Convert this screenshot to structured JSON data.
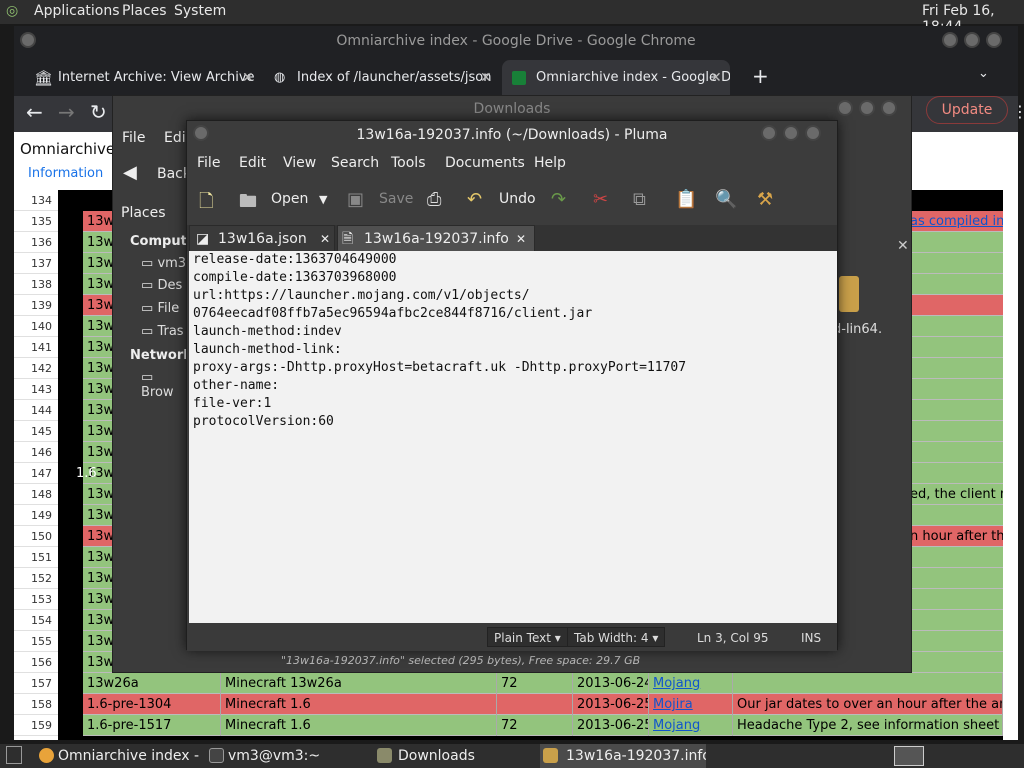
{
  "top_panel": {
    "applications": "Applications",
    "places": "Places",
    "system": "System",
    "clock": "Fri Feb 16, 18:44"
  },
  "chrome": {
    "title": "Omniarchive index - Google Drive - Google Chrome",
    "tabs": [
      {
        "label": "Internet Archive: View Archive"
      },
      {
        "label": "Index of /launcher/assets/json"
      },
      {
        "label": "Omniarchive index - Google D"
      }
    ],
    "update": "Update"
  },
  "sheet": {
    "title": "Omniarchive i",
    "info": "Information",
    "row_numbers": [
      "134",
      "135",
      "136",
      "137",
      "138",
      "139",
      "140",
      "141",
      "142",
      "143",
      "144",
      "145",
      "146",
      "147",
      "148",
      "149",
      "150",
      "151",
      "152",
      "153",
      "154",
      "155",
      "156",
      "157",
      "158",
      "159"
    ],
    "row_label_147": "1.6",
    "right_texts": {
      "r135": "as compiled in",
      "r139": "",
      "r148": "ed, the client m",
      "r150": "n hour after the"
    },
    "rows": [
      {
        "id": "13w26a",
        "name": "Minecraft 13w26a",
        "proto": "72",
        "date": "2013-06-24",
        "src": "Mojang",
        "note": ""
      },
      {
        "id": "1.6-pre-1304",
        "name": "Minecraft 1.6",
        "proto": "",
        "date": "2013-06-25",
        "src": "Mojira",
        "note": "Our jar dates to over an hour after the annou"
      },
      {
        "id": "1.6-pre-1517",
        "name": "Minecraft 1.6",
        "proto": "72",
        "date": "2013-06-25",
        "src": "Mojang",
        "note": "Headache Type 2, see information sheet"
      }
    ],
    "short_ids": [
      "13w",
      "13w",
      "13w",
      "13w",
      "13w",
      "13w",
      "13w",
      "13w",
      "13w",
      "13w",
      "13w",
      "13w",
      "13w",
      "13w",
      "13w",
      "13w",
      "13w",
      "13w",
      "13w",
      "13w",
      "13w",
      "13w26"
    ]
  },
  "downloads": {
    "title": "Downloads",
    "menu": {
      "file": "File",
      "edit": "Edit"
    },
    "back": "Back",
    "places_label": "Places",
    "sidebar": {
      "computer": "Compute",
      "vm3": "vm3",
      "desktop": "Des",
      "filesystem": "File",
      "trash": "Tras",
      "network": "Network",
      "browse": "Brow"
    },
    "file_label": "ed-lin64.",
    "status": "\"13w16a-192037.info\" selected (295 bytes), Free space: 29.7 GB"
  },
  "pluma": {
    "title": "13w16a-192037.info (~/Downloads) - Pluma",
    "menu": [
      "File",
      "Edit",
      "View",
      "Search",
      "Tools",
      "Documents",
      "Help"
    ],
    "toolbar": {
      "open": "Open",
      "save": "Save",
      "undo": "Undo"
    },
    "tabs": [
      {
        "label": "13w16a.json"
      },
      {
        "label": "13w16a-192037.info"
      }
    ],
    "lines": [
      "release-date:1363704649000",
      "compile-date:1363703968000",
      "url:https://launcher.mojang.com/v1/objects/",
      "0764eecadf08ffb7a5ec96594afbc2ce844f8716/client.jar",
      "launch-method:indev",
      "launch-method-link:",
      "proxy-args:-Dhttp.proxyHost=betacraft.uk -Dhttp.proxyPort=11707",
      "other-name:",
      "file-ver:1",
      "protocolVersion:60"
    ],
    "status": {
      "syntax": "Plain Text",
      "tabwidth": "Tab Width:  4",
      "position": "Ln 3, Col 95",
      "mode": "INS"
    }
  },
  "taskbar": {
    "items": [
      {
        "label": "Omniarchive index -..."
      },
      {
        "label": "vm3@vm3:~"
      },
      {
        "label": "Downloads"
      },
      {
        "label": "13w16a-192037.info..."
      }
    ]
  }
}
